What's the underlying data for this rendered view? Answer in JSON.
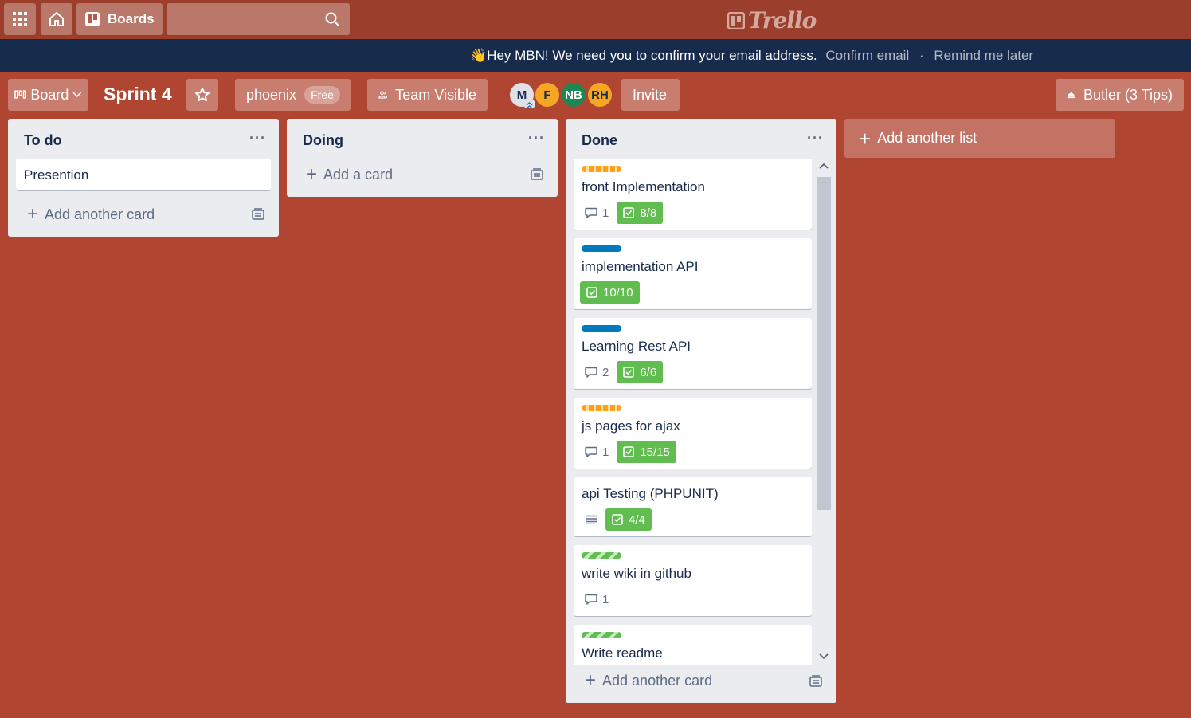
{
  "header": {
    "boards_label": "Boards",
    "search_placeholder": "",
    "logo_text": "Trello"
  },
  "banner": {
    "message": "👋Hey MBN! We need you to confirm your email address.",
    "confirm_link": "Confirm email",
    "separator": "·",
    "remind_link": "Remind me later"
  },
  "board": {
    "view_label": "Board",
    "title": "Sprint 4",
    "team_name": "phoenix",
    "team_badge": "Free",
    "visibility": "Team Visible",
    "invite_label": "Invite",
    "butler_label": "Butler (3 Tips)",
    "members": [
      "M",
      "F",
      "NB",
      "RH"
    ]
  },
  "lists": {
    "todo": {
      "title": "To do",
      "menu": "···",
      "cards": [
        {
          "title": "Presention"
        }
      ],
      "add_label": "Add another card"
    },
    "doing": {
      "title": "Doing",
      "menu": "···",
      "add_label": "Add a card"
    },
    "done": {
      "title": "Done",
      "menu": "···",
      "add_label": "Add another card",
      "cards": [
        {
          "title": "front Implementation",
          "label": "orange",
          "comments": "1",
          "checklist": "8/8"
        },
        {
          "title": "implementation API",
          "label": "blue",
          "checklist": "10/10"
        },
        {
          "title": "Learning Rest API",
          "label": "blue",
          "comments": "2",
          "checklist": "6/6"
        },
        {
          "title": "js pages for ajax",
          "label": "orange",
          "comments": "1",
          "checklist": "15/15"
        },
        {
          "title": "api Testing (PHPUNIT)",
          "description": true,
          "checklist": "4/4"
        },
        {
          "title": "write wiki in github",
          "label": "green",
          "comments": "1"
        },
        {
          "title": "Write readme",
          "label": "green"
        }
      ]
    }
  },
  "add_list_label": "Add another list",
  "colors": {
    "board_bg": "#b04632",
    "header_bg": "#9c3e2c",
    "banner_bg": "#172b4d",
    "checklist_complete": "#61bd4f",
    "label_orange": "#ff9f1a",
    "label_blue": "#0079bf",
    "label_green": "#61bd4f"
  }
}
